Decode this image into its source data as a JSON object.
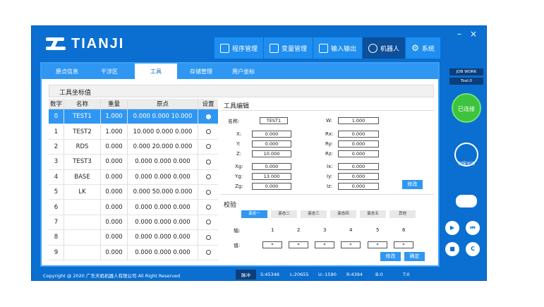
{
  "window": {
    "minimize": "–",
    "close": "×"
  },
  "brand": {
    "name": "TIANJI"
  },
  "topnav": [
    {
      "label": "程序管理",
      "icon": "edit-icon"
    },
    {
      "label": "变量管理",
      "icon": "variable-icon"
    },
    {
      "label": "输入输出",
      "icon": "io-icon"
    },
    {
      "label": "机器人",
      "icon": "robot-arm-icon"
    },
    {
      "label": "系统",
      "icon": "gear-icon"
    }
  ],
  "subtabs": [
    "原点信息",
    "干涉区",
    "工具",
    "存储管理",
    "用户坐标"
  ],
  "panel_title": "工具坐标值",
  "table": {
    "headers": [
      "数字",
      "名称",
      "重量",
      "原点",
      "设置"
    ],
    "rows": [
      {
        "num": "0",
        "name": "TEST1",
        "weight": "1.000",
        "origin": "0.000 0.000 10.000"
      },
      {
        "num": "1",
        "name": "TEST2",
        "weight": "1.000",
        "origin": "10.000 0.000 0.000"
      },
      {
        "num": "2",
        "name": "RDS",
        "weight": "0.000",
        "origin": "0.000 20.000 0.000"
      },
      {
        "num": "3",
        "name": "TEST3",
        "weight": "0.000",
        "origin": "0.000 0.000 0.000"
      },
      {
        "num": "4",
        "name": "BASE",
        "weight": "0.000",
        "origin": "0.000 0.000 0.000"
      },
      {
        "num": "5",
        "name": "LK",
        "weight": "0.000",
        "origin": "0.000 50.000 0.000"
      },
      {
        "num": "6",
        "name": "",
        "weight": "0.000",
        "origin": "0.000 0.000 0.000"
      },
      {
        "num": "7",
        "name": "",
        "weight": "0.000",
        "origin": "0.000 0.000 0.000"
      },
      {
        "num": "8",
        "name": "",
        "weight": "0.000",
        "origin": "0.000 0.000 0.000"
      },
      {
        "num": "9",
        "name": "",
        "weight": "0.000",
        "origin": "0.000 0.000 0.000"
      }
    ]
  },
  "tool_edit": {
    "header": "工具编辑",
    "name_label": "名称:",
    "name_value": "TEST1",
    "w_label": "W:",
    "w_value": "1.000",
    "x_label": "X:",
    "x_value": "0.000",
    "rx_label": "Rx:",
    "rx_value": "0.000",
    "y_label": "Y:",
    "y_value": "0.000",
    "ry_label": "Ry:",
    "ry_value": "0.000",
    "z_label": "Z:",
    "z_value": "10.000",
    "rz_label": "Rz:",
    "rz_value": "0.000",
    "xg_label": "Xg:",
    "xg_value": "0.000",
    "ix_label": "Ix:",
    "ix_value": "0.000",
    "yg_label": "Yg:",
    "yg_value": "13.000",
    "iy_label": "Iy:",
    "iy_value": "0.000",
    "zg_label": "Zg:",
    "zg_value": "0.000",
    "iz_label": "Iz:",
    "iz_value": "0.000",
    "modify": "修改"
  },
  "calibration": {
    "header": "校验",
    "tabs": [
      "姿态一",
      "姿态二",
      "姿态三",
      "姿态四",
      "姿态五",
      "其他"
    ],
    "axis_label": "轴:",
    "axes": [
      "1",
      "2",
      "3",
      "4",
      "5",
      "6"
    ],
    "value_label": "值:",
    "values": [
      "*",
      "*",
      "*",
      "*",
      "*",
      "*"
    ],
    "modify": "修改",
    "confirm": "确定"
  },
  "status": {
    "copyright": "Copyright @ 2020 广东天机机器人有限公司 All Right Reserved",
    "mode": "脉冲",
    "s": "S:45346",
    "l": "L:20655",
    "u": "U:-1580",
    "r": "R:4394",
    "b": "B:0",
    "t": "T:0"
  },
  "side": {
    "job": "JOB WORK",
    "tool": "Tool:0",
    "connected": "已连接",
    "power_label": "伺服关闭"
  },
  "colors": {
    "accent": "#2f97f2",
    "frame": "#0a6fd1",
    "connected": "#3dc43d"
  }
}
